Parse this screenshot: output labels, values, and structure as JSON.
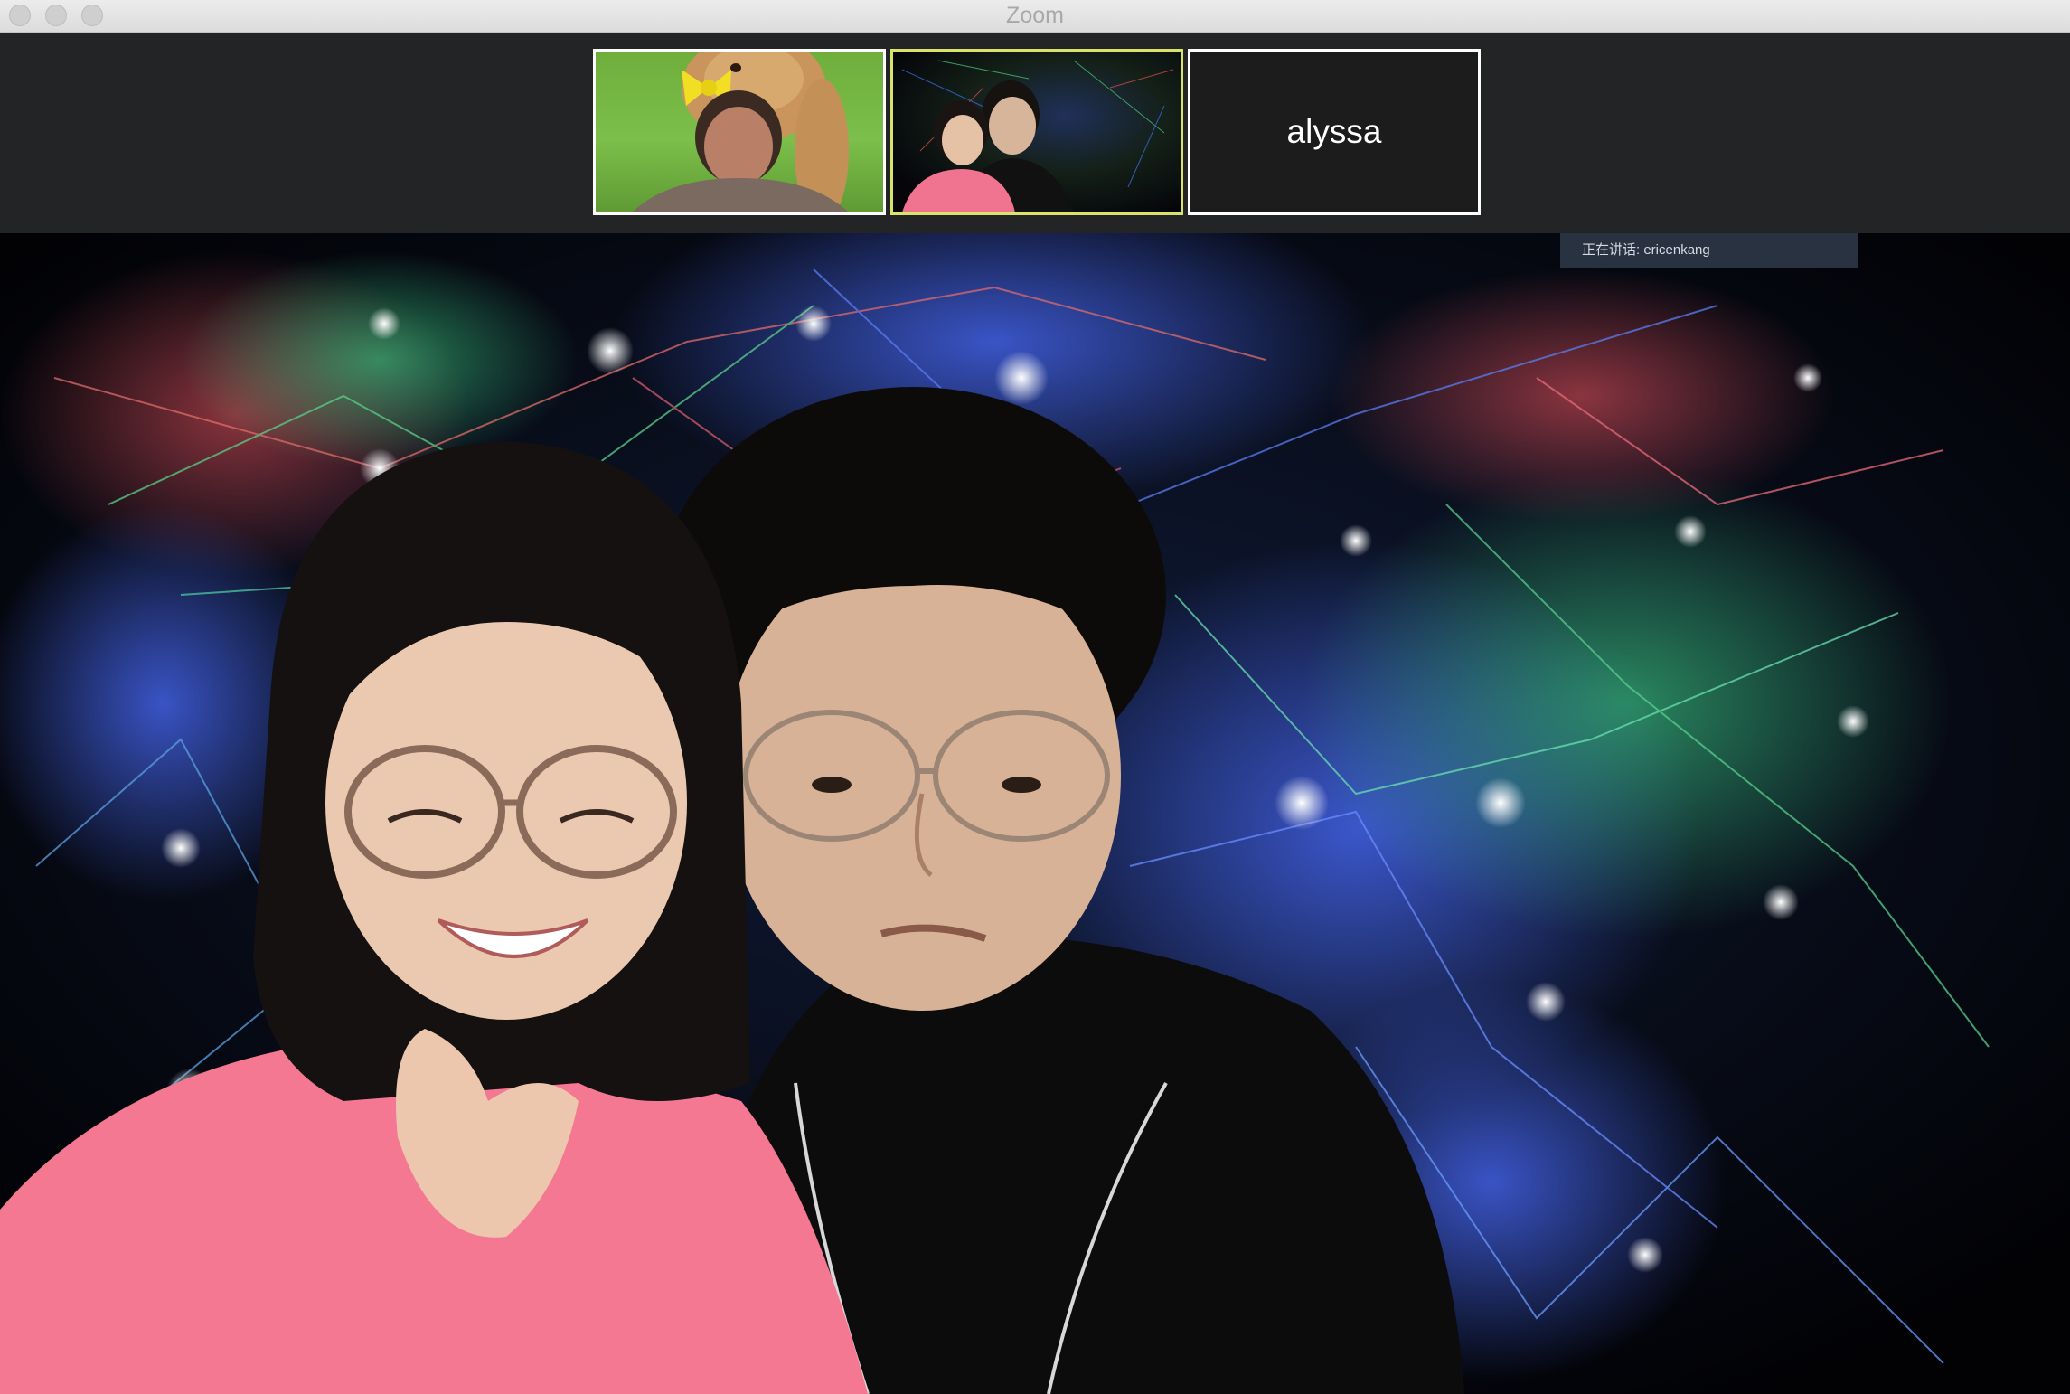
{
  "window": {
    "title": "Zoom"
  },
  "thumbnails": [
    {
      "kind": "video",
      "description_icon": "participant-video"
    },
    {
      "kind": "video",
      "active_speaker": true,
      "description_icon": "participant-video"
    },
    {
      "kind": "name",
      "name": "alyssa"
    }
  ],
  "main": {
    "speaking_banner": "正在讲话: ericenkang"
  },
  "colors": {
    "titlebar": "#e6e6e6",
    "strip_bg": "#232425",
    "thumb_border": "#ffffff",
    "active_speaker_border": "#d9e36a",
    "banner_bg": "#283241"
  }
}
